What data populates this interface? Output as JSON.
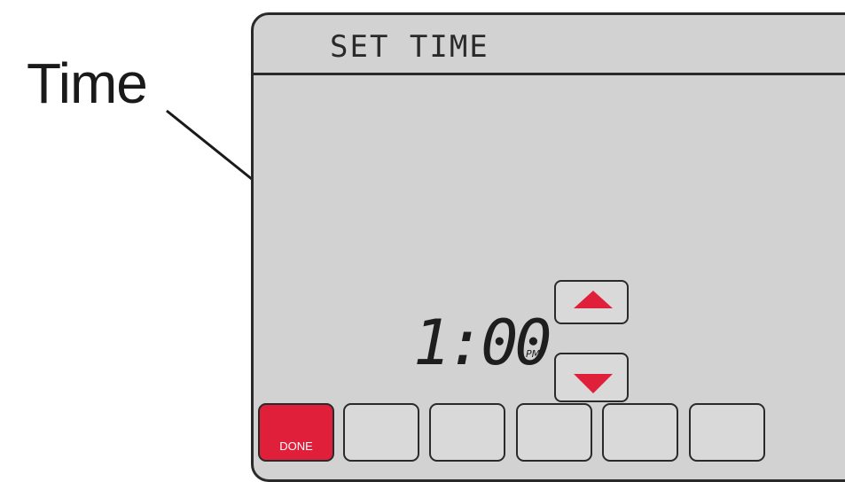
{
  "callout": {
    "label": "Time"
  },
  "screen": {
    "title": "SET TIME",
    "time": {
      "value": "1:00",
      "period": "PM"
    },
    "up_icon": "triangle-up-icon",
    "down_icon": "triangle-down-icon",
    "softkeys": [
      {
        "label": "DONE",
        "color": "#e0203a"
      },
      {
        "label": ""
      },
      {
        "label": ""
      },
      {
        "label": ""
      },
      {
        "label": ""
      },
      {
        "label": ""
      }
    ]
  },
  "colors": {
    "screen_bg": "#d2d2d2",
    "accent": "#e0203a",
    "outline": "#2a2a2a"
  }
}
